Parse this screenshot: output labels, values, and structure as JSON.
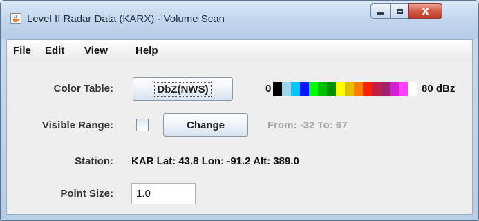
{
  "window": {
    "title": "Level II Radar Data (KARX) - Volume Scan",
    "icon": "java-coffee-icon",
    "controls": {
      "minimize": "minimize-icon",
      "maximize": "maximize-icon",
      "close": "close-icon",
      "close_glyph": "x"
    },
    "close_color": "#c0392b"
  },
  "menu": [
    {
      "label": "File",
      "mnemonic": "F",
      "rest": "ile"
    },
    {
      "label": "Edit",
      "mnemonic": "E",
      "rest": "dit"
    },
    {
      "label": "View",
      "mnemonic": "V",
      "rest": "iew"
    },
    {
      "label": "Help",
      "mnemonic": "H",
      "rest": "elp"
    }
  ],
  "color_table": {
    "label": "Color Table:",
    "button": "DbZ(NWS)",
    "min_label": "0",
    "max_label": "80 dBz",
    "colors": [
      "#000000",
      "#9dd5e8",
      "#00c8ff",
      "#0018ff",
      "#00ff00",
      "#00c000",
      "#009000",
      "#ffff00",
      "#e0c000",
      "#ff8000",
      "#ff2000",
      "#c02040",
      "#a02070",
      "#d020d0",
      "#ff40ff",
      "#ffffff"
    ]
  },
  "visible_range": {
    "label": "Visible Range:",
    "checked": false,
    "button": "Change",
    "range_text": "From: -32 To: 67"
  },
  "station": {
    "label": "Station:",
    "value": "KAR Lat: 43.8 Lon: -91.2 Alt: 389.0"
  },
  "point_size": {
    "label": "Point Size:",
    "value": "1.0"
  }
}
